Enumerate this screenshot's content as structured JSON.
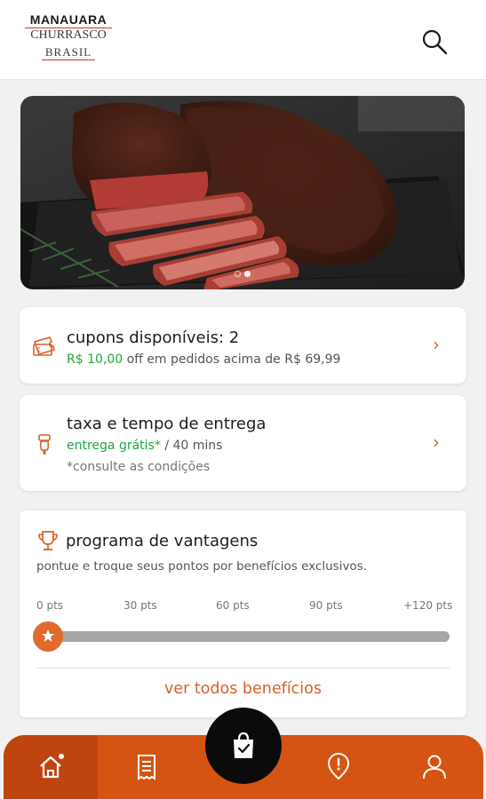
{
  "brand": {
    "line1": "MANAUARA",
    "line2": "CHURRASCO",
    "line3": "BRASIL"
  },
  "header": {
    "search_icon": "search-icon"
  },
  "banner": {
    "image": "grilled-steak-photo",
    "dots": 2,
    "active_dot": 1
  },
  "coupons": {
    "title": "cupons disponíveis: 2",
    "discount": "R$ 10,00",
    "condition": "off em pedidos acima de R$ 69,99",
    "icon": "ticket-icon"
  },
  "delivery": {
    "title": "taxa e tempo de entrega",
    "free_label": "entrega grátis*",
    "time": "/ 40 mins",
    "note": "*consulte as condições",
    "icon": "scooter-icon"
  },
  "rewards": {
    "title": "programa de vantagens",
    "description": "pontue e troque seus pontos por benefícios exclusivos.",
    "ticks": [
      "0 pts",
      "30 pts",
      "60 pts",
      "90 pts",
      "+120 pts"
    ],
    "progress_fraction": 0.0,
    "link": "ver todos benefícios",
    "icon": "trophy-icon"
  },
  "bottom_nav": {
    "items": [
      "home-icon",
      "receipt-icon",
      "bag-icon",
      "info-icon",
      "user-icon"
    ],
    "active": "home"
  },
  "colors": {
    "accent": "#d65413",
    "green": "#1fa83a",
    "dark": "#0b0b0b"
  }
}
